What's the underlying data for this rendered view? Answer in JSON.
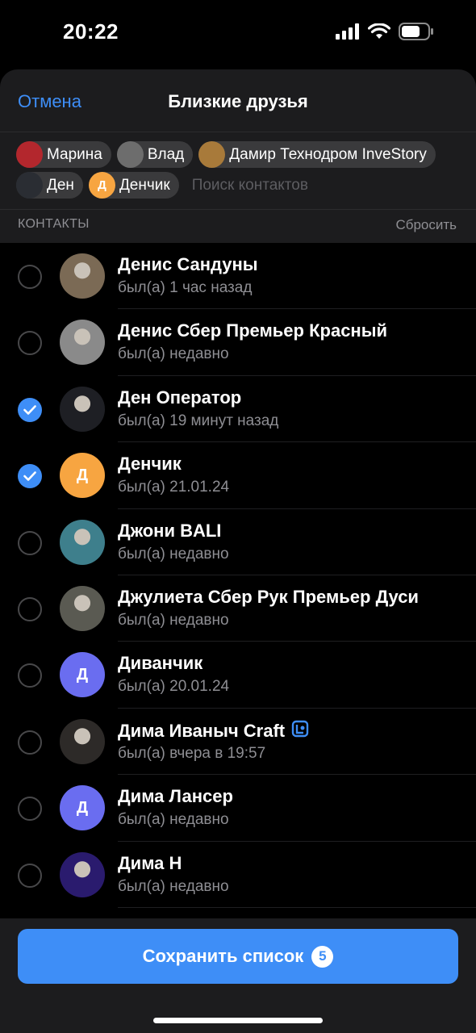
{
  "status_bar": {
    "time": "20:22"
  },
  "nav": {
    "cancel": "Отмена",
    "title": "Близкие друзья"
  },
  "chips": [
    {
      "label": "Марина",
      "avatar_color": "#b3272d",
      "initial": ""
    },
    {
      "label": "Влад",
      "avatar_color": "#6d6d6d",
      "initial": ""
    },
    {
      "label": "Дамир Технодром InveStory",
      "avatar_color": "#a87a3a",
      "initial": ""
    },
    {
      "label": "Ден",
      "avatar_color": "#2a2d33",
      "initial": ""
    },
    {
      "label": "Денчик",
      "avatar_color": "#f7a541",
      "initial": "Д"
    }
  ],
  "search": {
    "placeholder": "Поиск контактов"
  },
  "section": {
    "label": "КОНТАКТЫ",
    "reset": "Сбросить"
  },
  "contacts": [
    {
      "name": "Денис Сандуны",
      "status": "был(а) 1 час назад",
      "checked": false,
      "avatar_color": "#7b6a55",
      "initial": ""
    },
    {
      "name": "Денис Сбер Премьер Красный",
      "status": "был(а) недавно",
      "checked": false,
      "avatar_color": "#8a8a8a",
      "initial": ""
    },
    {
      "name": "Ден Оператор",
      "status": "был(а) 19 минут назад",
      "checked": true,
      "avatar_color": "#1e1f24",
      "initial": ""
    },
    {
      "name": "Денчик",
      "status": "был(а) 21.01.24",
      "checked": true,
      "avatar_color": "#f7a541",
      "initial": "Д"
    },
    {
      "name": "Джони BALI",
      "status": "был(а) недавно",
      "checked": false,
      "avatar_color": "#3e7f8c",
      "initial": ""
    },
    {
      "name": "Джулиета Сбер Рук Премьер Дуси",
      "status": "был(а) недавно",
      "checked": false,
      "avatar_color": "#5a5a52",
      "initial": ""
    },
    {
      "name": "Диванчик",
      "status": "был(а) 20.01.24",
      "checked": false,
      "avatar_color": "#6a6df0",
      "initial": "Д"
    },
    {
      "name": "Дима Иваныч Craft",
      "status": "был(а) вчера в 19:57",
      "checked": false,
      "avatar_color": "#2d2a28",
      "initial": "",
      "premium_icon": "premium-badge-icon"
    },
    {
      "name": "Дима Лансер",
      "status": "был(а) недавно",
      "checked": false,
      "avatar_color": "#6a6df0",
      "initial": "Д"
    },
    {
      "name": "Дима Н",
      "status": "был(а) недавно",
      "checked": false,
      "avatar_color": "#2a1b6e",
      "initial": ""
    }
  ],
  "save_button": {
    "label": "Сохранить список",
    "count": "5"
  },
  "colors": {
    "accent": "#3e8ef7",
    "background": "#000000",
    "sheet": "#1c1c1e"
  }
}
